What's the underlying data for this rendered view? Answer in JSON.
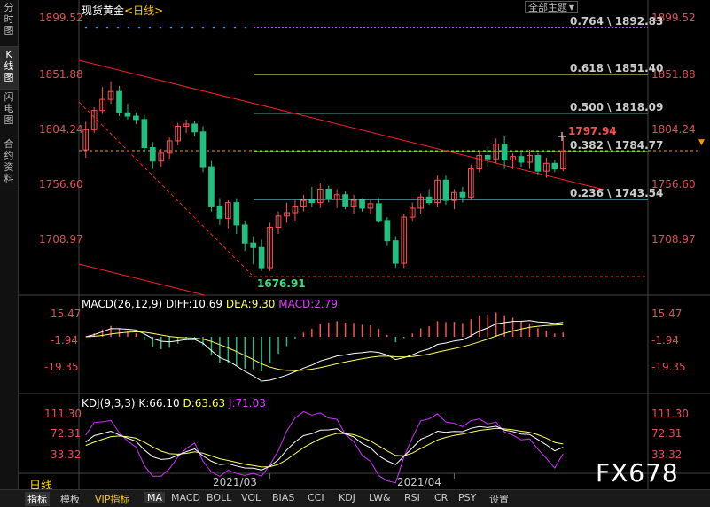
{
  "sidebar": {
    "tabs": [
      {
        "label": "分\n时\n图",
        "active": false
      },
      {
        "label": "K\n线\n图",
        "active": true
      },
      {
        "label": "闪\n电\n图",
        "active": false
      },
      {
        "label": "合\n约\n资\n料",
        "active": false
      }
    ]
  },
  "header": {
    "instrument": "现货黄金",
    "period": "<日线>",
    "theme_button": "全部主题",
    "theme_arrow": "▼"
  },
  "price_axis": {
    "ticks": [
      "1899.52",
      "1851.88",
      "1804.24",
      "1756.60",
      "1708.97"
    ],
    "right_marker": "▼"
  },
  "fibonacci": [
    {
      "label": "0.764 \\ 1892.83",
      "color": "#c050ff"
    },
    {
      "label": "0.618 \\ 1851.40",
      "color": "#ffff80"
    },
    {
      "label": "0.500 \\ 1818.09",
      "color": "#50a0a0"
    },
    {
      "label": "0.382 \\ 1784.77",
      "color": "#40ff40"
    },
    {
      "label": "0.236 \\ 1743.54",
      "color": "#80ffff"
    }
  ],
  "annotations": {
    "high": "1797.94",
    "low": "1676.91"
  },
  "macd": {
    "title": "MACD(26,12,9)",
    "diff": "DIFF:10.69",
    "dea": "DEA:9.30",
    "macd": "MACD:2.79",
    "ticks": [
      "15.47",
      "-1.94",
      "-19.35"
    ]
  },
  "kdj": {
    "title": "KDJ(9,3,3)",
    "k": "K:66.10",
    "d": "D:63.63",
    "j": "J:71.03",
    "ticks": [
      "111.30",
      "72.31",
      "33.32"
    ]
  },
  "time_axis": {
    "labels": [
      "2021/03",
      "2021/04"
    ]
  },
  "period_label": "日线",
  "bottom_bar": {
    "items": [
      "指标",
      "模板",
      "VIP指标",
      "MA",
      "MACD",
      "BOLL",
      "VOL",
      "BIAS",
      "CCI",
      "KDJ",
      "LW&",
      "RSI",
      "CR",
      "PSY",
      "设置"
    ]
  },
  "watermark": "FX678",
  "colors": {
    "up": "#ff5050",
    "down": "#20c080",
    "axis": "#e05050",
    "diff_line": "#ffffff",
    "dea_line": "#ffff60",
    "j_line": "#d030ff"
  },
  "chart_data": {
    "type": "candlestick",
    "candles": [
      {
        "o": 1785,
        "h": 1810,
        "l": 1778,
        "c": 1803
      },
      {
        "o": 1803,
        "h": 1823,
        "l": 1800,
        "c": 1820
      },
      {
        "o": 1820,
        "h": 1841,
        "l": 1817,
        "c": 1830
      },
      {
        "o": 1830,
        "h": 1846,
        "l": 1826,
        "c": 1837
      },
      {
        "o": 1837,
        "h": 1842,
        "l": 1815,
        "c": 1818
      },
      {
        "o": 1818,
        "h": 1826,
        "l": 1812,
        "c": 1815
      },
      {
        "o": 1815,
        "h": 1818,
        "l": 1808,
        "c": 1812
      },
      {
        "o": 1812,
        "h": 1816,
        "l": 1783,
        "c": 1787
      },
      {
        "o": 1787,
        "h": 1792,
        "l": 1768,
        "c": 1775
      },
      {
        "o": 1775,
        "h": 1786,
        "l": 1770,
        "c": 1782
      },
      {
        "o": 1782,
        "h": 1796,
        "l": 1777,
        "c": 1793
      },
      {
        "o": 1793,
        "h": 1809,
        "l": 1789,
        "c": 1806
      },
      {
        "o": 1806,
        "h": 1812,
        "l": 1800,
        "c": 1808
      },
      {
        "o": 1808,
        "h": 1811,
        "l": 1797,
        "c": 1801
      },
      {
        "o": 1801,
        "h": 1806,
        "l": 1765,
        "c": 1770
      },
      {
        "o": 1770,
        "h": 1775,
        "l": 1730,
        "c": 1735
      },
      {
        "o": 1735,
        "h": 1742,
        "l": 1718,
        "c": 1724
      },
      {
        "o": 1724,
        "h": 1740,
        "l": 1715,
        "c": 1738
      },
      {
        "o": 1738,
        "h": 1742,
        "l": 1710,
        "c": 1718
      },
      {
        "o": 1718,
        "h": 1722,
        "l": 1695,
        "c": 1702
      },
      {
        "o": 1702,
        "h": 1708,
        "l": 1683,
        "c": 1698
      },
      {
        "o": 1698,
        "h": 1705,
        "l": 1677,
        "c": 1680
      },
      {
        "o": 1680,
        "h": 1720,
        "l": 1677,
        "c": 1716
      },
      {
        "o": 1716,
        "h": 1730,
        "l": 1710,
        "c": 1726
      },
      {
        "o": 1726,
        "h": 1738,
        "l": 1720,
        "c": 1729
      },
      {
        "o": 1729,
        "h": 1740,
        "l": 1722,
        "c": 1735
      },
      {
        "o": 1735,
        "h": 1745,
        "l": 1730,
        "c": 1740
      },
      {
        "o": 1740,
        "h": 1752,
        "l": 1734,
        "c": 1738
      },
      {
        "o": 1738,
        "h": 1755,
        "l": 1733,
        "c": 1750
      },
      {
        "o": 1750,
        "h": 1753,
        "l": 1738,
        "c": 1741
      },
      {
        "o": 1741,
        "h": 1750,
        "l": 1733,
        "c": 1745
      },
      {
        "o": 1745,
        "h": 1748,
        "l": 1732,
        "c": 1735
      },
      {
        "o": 1735,
        "h": 1745,
        "l": 1728,
        "c": 1740
      },
      {
        "o": 1740,
        "h": 1742,
        "l": 1730,
        "c": 1733
      },
      {
        "o": 1733,
        "h": 1740,
        "l": 1728,
        "c": 1737
      },
      {
        "o": 1737,
        "h": 1742,
        "l": 1720,
        "c": 1722
      },
      {
        "o": 1722,
        "h": 1725,
        "l": 1700,
        "c": 1704
      },
      {
        "o": 1704,
        "h": 1708,
        "l": 1680,
        "c": 1684
      },
      {
        "o": 1684,
        "h": 1728,
        "l": 1680,
        "c": 1725
      },
      {
        "o": 1725,
        "h": 1738,
        "l": 1722,
        "c": 1733
      },
      {
        "o": 1733,
        "h": 1746,
        "l": 1728,
        "c": 1743
      },
      {
        "o": 1743,
        "h": 1750,
        "l": 1736,
        "c": 1738
      },
      {
        "o": 1738,
        "h": 1762,
        "l": 1734,
        "c": 1758
      },
      {
        "o": 1758,
        "h": 1762,
        "l": 1736,
        "c": 1740
      },
      {
        "o": 1740,
        "h": 1750,
        "l": 1732,
        "c": 1747
      },
      {
        "o": 1747,
        "h": 1752,
        "l": 1738,
        "c": 1743
      },
      {
        "o": 1743,
        "h": 1772,
        "l": 1740,
        "c": 1768
      },
      {
        "o": 1768,
        "h": 1784,
        "l": 1765,
        "c": 1780
      },
      {
        "o": 1780,
        "h": 1788,
        "l": 1770,
        "c": 1777
      },
      {
        "o": 1777,
        "h": 1795,
        "l": 1773,
        "c": 1790
      },
      {
        "o": 1790,
        "h": 1797,
        "l": 1768,
        "c": 1776
      },
      {
        "o": 1776,
        "h": 1782,
        "l": 1768,
        "c": 1779
      },
      {
        "o": 1779,
        "h": 1784,
        "l": 1770,
        "c": 1774
      },
      {
        "o": 1774,
        "h": 1785,
        "l": 1768,
        "c": 1780
      },
      {
        "o": 1780,
        "h": 1782,
        "l": 1762,
        "c": 1766
      },
      {
        "o": 1766,
        "h": 1778,
        "l": 1760,
        "c": 1773
      },
      {
        "o": 1773,
        "h": 1776,
        "l": 1765,
        "c": 1768
      },
      {
        "o": 1768,
        "h": 1798,
        "l": 1766,
        "c": 1784
      }
    ],
    "ylim": [
      1676.91,
      1899.52
    ],
    "x_labels": [
      "2021/03",
      "2021/04"
    ],
    "macd_range": [
      -25,
      20
    ],
    "kdj_range": [
      0,
      120
    ]
  }
}
